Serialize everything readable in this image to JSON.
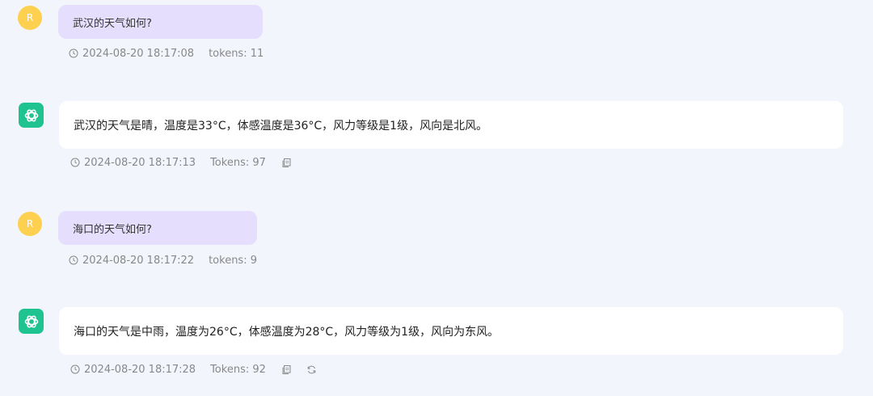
{
  "messages": [
    {
      "role": "user",
      "avatar_letter": "R",
      "text": "武汉的天气如何?",
      "timestamp": "2024-08-20 18:17:08",
      "tokens": "tokens: 11"
    },
    {
      "role": "assistant",
      "avatar_icon": "openai-logo-icon",
      "text": "武汉的天气是晴，温度是33°C，体感温度是36°C，风力等级是1级，风向是北风。",
      "timestamp": "2024-08-20 18:17:13",
      "tokens": "Tokens: 97"
    },
    {
      "role": "user",
      "avatar_letter": "R",
      "text": "海口的天气如何?",
      "timestamp": "2024-08-20 18:17:22",
      "tokens": "tokens: 9"
    },
    {
      "role": "assistant",
      "avatar_icon": "openai-logo-icon",
      "text": "海口的天气是中雨，温度为26°C，体感温度为28°C，风力等级为1级，风向为东风。",
      "timestamp": "2024-08-20 18:17:28",
      "tokens": "Tokens: 92"
    }
  ],
  "colors": {
    "background": "#f3f5fc",
    "user_avatar": "#fdd04f",
    "bot_avatar": "#1fc38f",
    "user_bubble": "#e5defc",
    "bot_bubble": "#ffffff",
    "meta_text": "#888888"
  },
  "icons": {
    "timestamp": "clock-icon",
    "copy": "copy-icon",
    "regenerate": "refresh-icon"
  }
}
